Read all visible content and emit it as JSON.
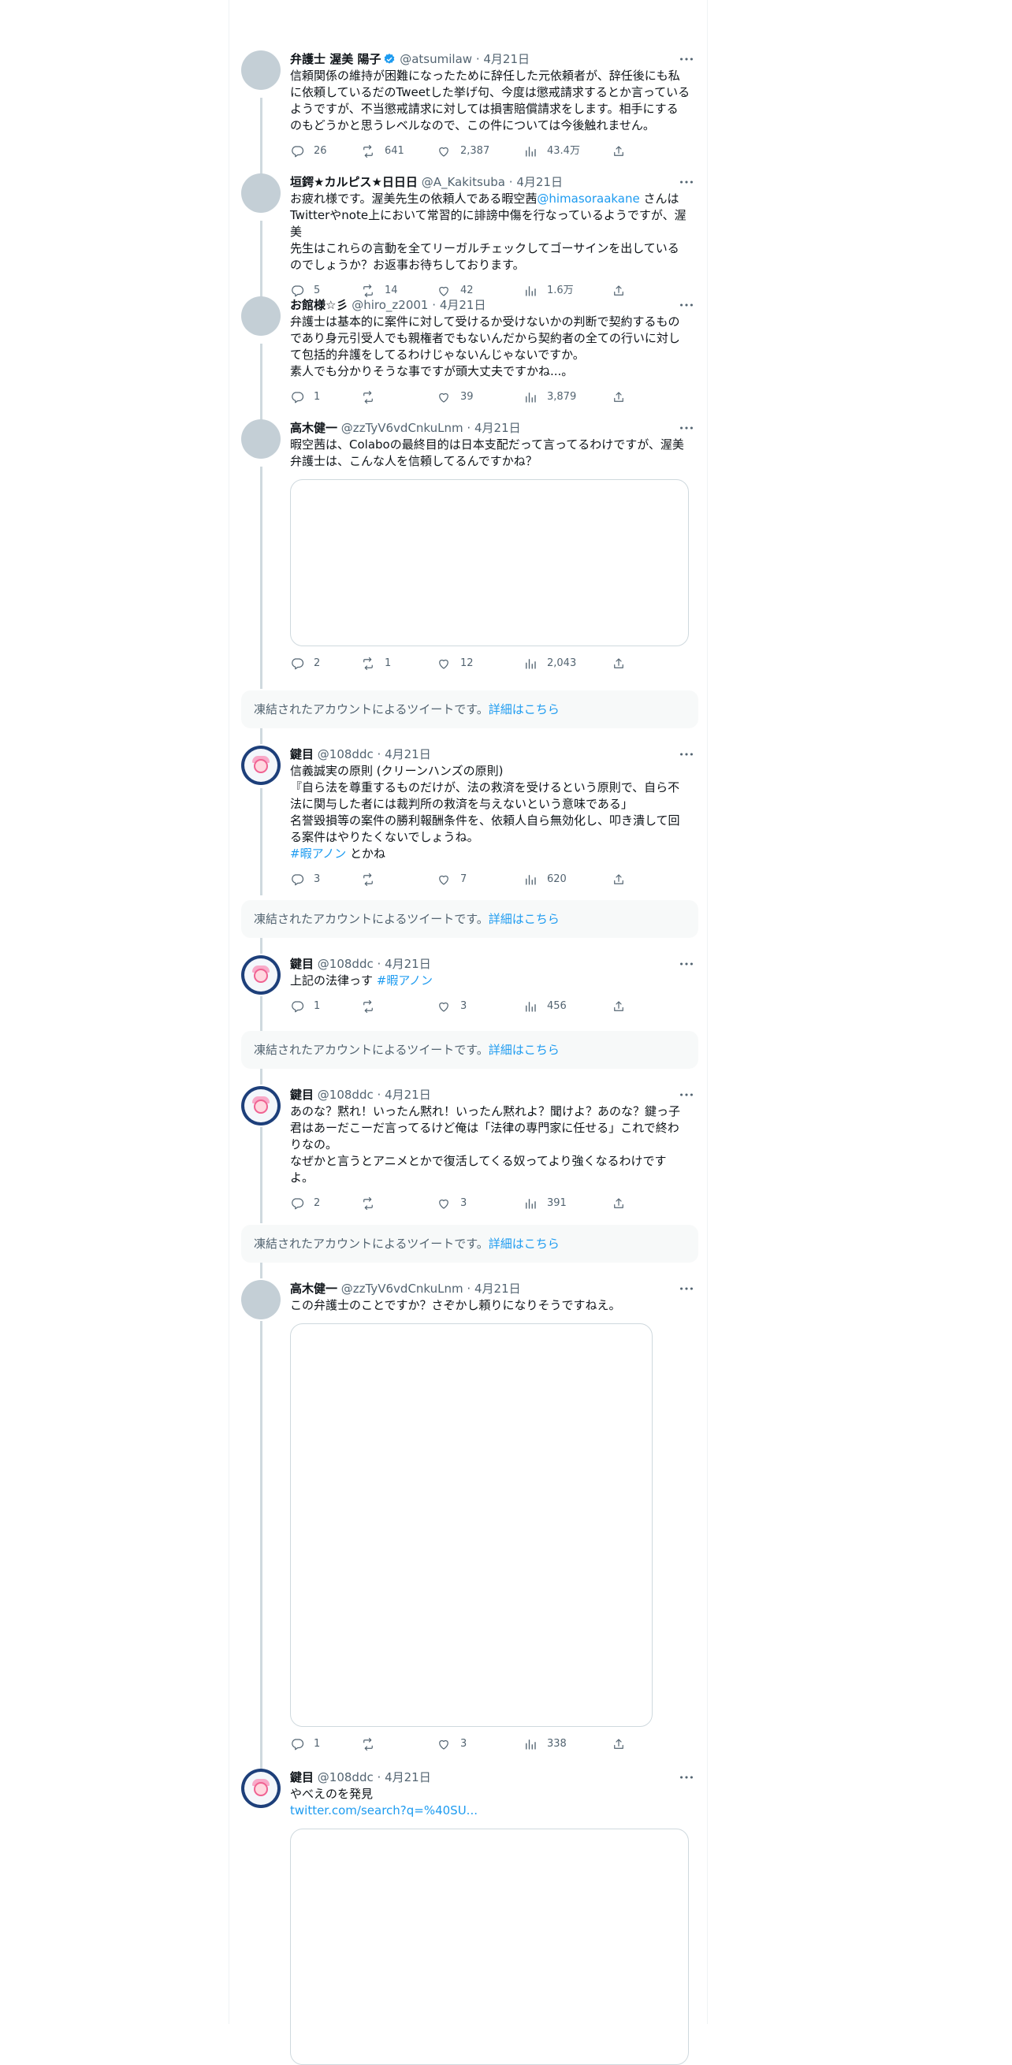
{
  "tweets": [
    {
      "name": "弁護士 渥美 陽子",
      "verified": true,
      "handle": "@atsumilaw",
      "date": "4月21日",
      "text": "信頼関係の維持が困難になったために辞任した元依頼者が、辞任後にも私\nに依頼しているだのTweetした挙げ句、今度は懲戒請求するとか言っている\nようですが、不当懲戒請求に対しては損害賠償請求をします。相手にする\nのもどうかと思うレベルなので、この件については今後触れません。",
      "replies": "26",
      "retweets": "641",
      "likes": "2,387",
      "views": "43.4万"
    },
    {
      "name": "垣鍔★カルピス★日日日",
      "handle": "@A_Kakitsuba",
      "date": "4月21日",
      "text_a": "お疲れ様です。渥美先生の依頼人である暇空茜",
      "mention": "@himasoraakane",
      "text_b": " さんは\nTwitterやnote上において常習的に誹謗中傷を行なっているようですが、渥美\n先生はこれらの言動を全てリーガルチェックしてゴーサインを出している\nのでしょうか？お返事お待ちしております。",
      "replies": "5",
      "retweets": "14",
      "likes": "42",
      "views": "1.6万"
    },
    {
      "name": "お館様☆彡",
      "handle": "@hiro_z2001",
      "date": "4月21日",
      "text": "弁護士は基本的に案件に対して受けるか受けないかの判断で契約するもの\nであり身元引受人でも親権者でもないんだから契約者の全ての行いに対し\nて包括的弁護をしてるわけじゃないんじゃないですか。\n素人でも分かりそうな事ですが頭大丈夫ですかね...。",
      "replies": "1",
      "retweets": "",
      "likes": "39",
      "views": "3,879"
    },
    {
      "name": "高木健一",
      "handle": "@zzTyV6vdCnkuLnm",
      "date": "4月21日",
      "text": "暇空茜は、Colaboの最終目的は日本支配だって言ってるわけですが、渥美\n弁護士は、こんな人を信頼してるんですかね？",
      "replies": "2",
      "retweets": "1",
      "likes": "12",
      "views": "2,043"
    },
    {
      "name": "鍵目",
      "handle": "@108ddc",
      "date": "4月21日",
      "text": "信義誠実の原則 (クリーンハンズの原則)\n『自ら法を尊重するものだけが、法の救済を受けるという原則で、自ら不\n法に関与した者には裁判所の救済を与えないという意味である」\n名誉毀損等の案件の勝利報酬条件を、依頼人自ら無効化し、叩き潰して回\nる案件はやりたくないでしょうね。",
      "hashtag": "#暇アノン",
      "tail": " とかね",
      "replies": "3",
      "retweets": "",
      "likes": "7",
      "views": "620"
    },
    {
      "name": "鍵目",
      "handle": "@108ddc",
      "date": "4月21日",
      "text": "上記の法律っす ",
      "hashtag": "#暇アノン",
      "replies": "1",
      "retweets": "",
      "likes": "3",
      "views": "456"
    },
    {
      "name": "鍵目",
      "handle": "@108ddc",
      "date": "4月21日",
      "text": "あのな？黙れ！いったん黙れ！いったん黙れよ？聞けよ？あのな？鍵っ子\n君はあーだこーだ言ってるけど俺は「法律の専門家に任せる」これで終わ\nりなの。\nなぜかと言うとアニメとかで復活してくる奴ってより強くなるわけです\nよ。",
      "replies": "2",
      "retweets": "",
      "likes": "3",
      "views": "391"
    },
    {
      "name": "高木健一",
      "handle": "@zzTyV6vdCnkuLnm",
      "date": "4月21日",
      "text": "この弁護士のことですか？さぞかし頼りになりそうですねえ。",
      "replies": "1",
      "retweets": "",
      "likes": "3",
      "views": "338"
    },
    {
      "name": "鍵目",
      "handle": "@108ddc",
      "date": "4月21日",
      "text": "やべえのを発見",
      "link": "twitter.com/search?q=%40SU..."
    }
  ],
  "notice": {
    "text": "凍結されたアカウントによるツイートです。",
    "link": "詳細はこちら"
  },
  "separator": "·",
  "colors": {
    "link": "#1d9bf0",
    "secondary": "#536471",
    "verified": "#1d9bf0",
    "thread_line": "#cfd9de",
    "notice_bg": "#f7f9f9"
  },
  "icons": [
    "reply-icon",
    "retweet-icon",
    "like-icon",
    "views-icon",
    "share-icon",
    "more-icon",
    "verified-badge-icon"
  ]
}
